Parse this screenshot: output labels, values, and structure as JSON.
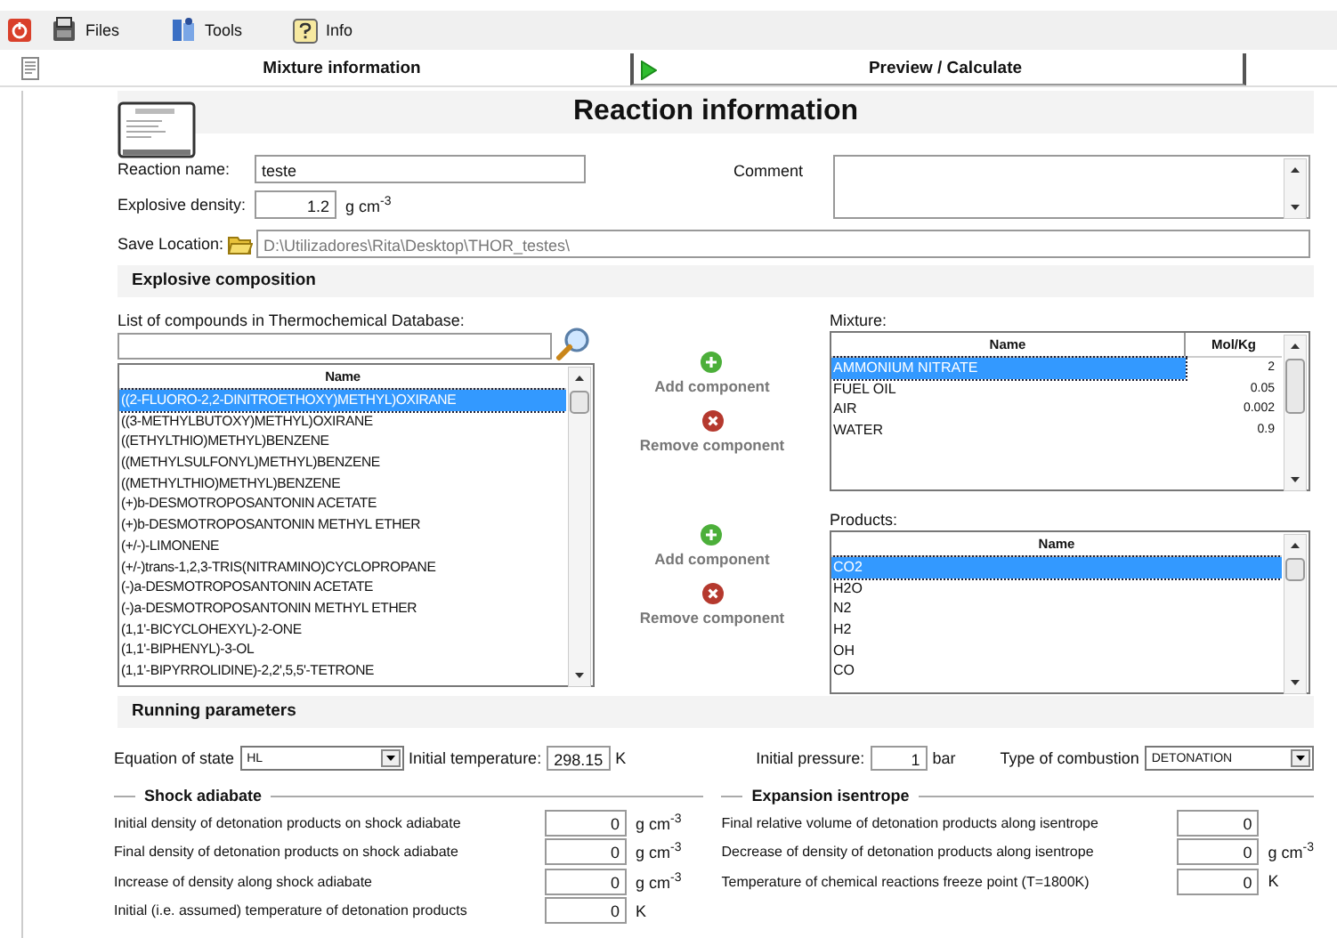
{
  "menu": [
    {
      "label": "Files",
      "kind": "files"
    },
    {
      "label": "Tools",
      "kind": "tools"
    },
    {
      "label": "Info",
      "kind": "info"
    }
  ],
  "tabs": [
    {
      "label": "Mixture information",
      "selected": true
    },
    {
      "label": "Preview / Calculate",
      "selected": false
    }
  ],
  "title": "Reaction information",
  "reaction": {
    "name_label": "Reaction name:",
    "name_value": "teste",
    "density_label": "Explosive density:",
    "density_value": "1.2",
    "density_unit": "g cm$^{-3}$",
    "comment_label": "Comment",
    "save_label": "Save Location:",
    "save_value": "D:\\Utilizadores\\Rita\\Desktop\\THOR_testes\\"
  },
  "composition": {
    "title": "Explosive composition",
    "database": {
      "label": "List of compounds in Thermochemical Database:",
      "column": "Name",
      "rows": [
        {
          "name": "((2-FLUORO-2,2-DINITROETHOXY)METHYL)OXIRANE",
          "selected": true
        },
        {
          "name": "((3-METHYLBUTOXY)METHYL)OXIRANE",
          "selected": false
        },
        {
          "name": "((ETHYLTHIO)METHYL)BENZENE",
          "selected": false
        },
        {
          "name": "((METHYLSULFONYL)METHYL)BENZENE",
          "selected": false
        },
        {
          "name": "((METHYLTHIO)METHYL)BENZENE",
          "selected": false
        },
        {
          "name": "(+)b-DESMOTROPOSANTONIN ACETATE",
          "selected": false
        },
        {
          "name": "(+)b-DESMOTROPOSANTONIN METHYL ETHER",
          "selected": false
        },
        {
          "name": "(+/-)-LIMONENE",
          "selected": false
        },
        {
          "name": "(+/-)trans-1,2,3-TRIS(NITRAMINO)CYCLOPROPANE",
          "selected": false
        },
        {
          "name": "(-)a-DESMOTROPOSANTONIN ACETATE",
          "selected": false
        },
        {
          "name": "(-)a-DESMOTROPOSANTONIN METHYL ETHER",
          "selected": false
        },
        {
          "name": "(1,1'-BICYCLOHEXYL)-2-ONE",
          "selected": false
        },
        {
          "name": "(1,1'-BIPHENYL)-3-OL",
          "selected": false
        },
        {
          "name": "(1,1'-BIPYRROLIDINE)-2,2',5,5'-TETRONE",
          "selected": false
        }
      ]
    },
    "mixture_actions": [
      {
        "kind": "add",
        "label": "Add component"
      },
      {
        "kind": "remove",
        "label": "Remove component"
      }
    ],
    "product_actions": [
      {
        "kind": "add",
        "label": "Add component"
      },
      {
        "kind": "remove",
        "label": "Remove component"
      }
    ],
    "mixture": {
      "label": "Mixture:",
      "columns": [
        "Name",
        "Mol/Kg"
      ],
      "rows": [
        {
          "name": "AMMONIUM NITRATE",
          "value": "2",
          "selected": true
        },
        {
          "name": "FUEL OIL",
          "value": "0.05",
          "selected": false
        },
        {
          "name": "AIR",
          "value": "0.002",
          "selected": false
        },
        {
          "name": "WATER",
          "value": "0.9",
          "selected": false
        }
      ]
    },
    "products": {
      "label": "Products:",
      "column": "Name",
      "rows": [
        {
          "name": "CO2",
          "selected": true
        },
        {
          "name": "H2O",
          "selected": false
        },
        {
          "name": "N2",
          "selected": false
        },
        {
          "name": "H2",
          "selected": false
        },
        {
          "name": "OH",
          "selected": false
        },
        {
          "name": "CO",
          "selected": false
        }
      ]
    }
  },
  "running": {
    "title": "Running parameters",
    "eos_label": "Equation of state",
    "eos_value": "HL",
    "temp_label": "Initial temperature:",
    "temp_value": "298.15",
    "temp_unit": "K",
    "pressure_label": "Initial pressure:",
    "pressure_value": "1",
    "pressure_unit": "bar",
    "combustion_label": "Type of combustion",
    "combustion_value": "DETONATION"
  },
  "groups": [
    {
      "title": "Shock adiabate",
      "rows": [
        {
          "label": "Initial density of detonation products on shock adiabate",
          "value": "0",
          "unit": "g cm$^{-3}$"
        },
        {
          "label": "Final density of detonation products on shock adiabate",
          "value": "0",
          "unit": "g cm$^{-3}$"
        },
        {
          "label": "Increase of density along shock adiabate",
          "value": "0",
          "unit": "g cm$^{-3}$"
        },
        {
          "label": "Initial (i.e. assumed) temperature of detonation products",
          "value": "0",
          "unit": "K"
        }
      ]
    },
    {
      "title": "Expansion isentrope",
      "rows": [
        {
          "label": "Final relative volume of detonation products along isentrope",
          "value": "0"
        },
        {
          "label": "Decrease of density of detonation products along isentrope",
          "value": "0",
          "unit": "g cm$^{-3}$"
        },
        {
          "label": "Temperature of chemical reactions freeze point (T=1800K)",
          "value": "0",
          "unit": "K"
        }
      ]
    }
  ]
}
